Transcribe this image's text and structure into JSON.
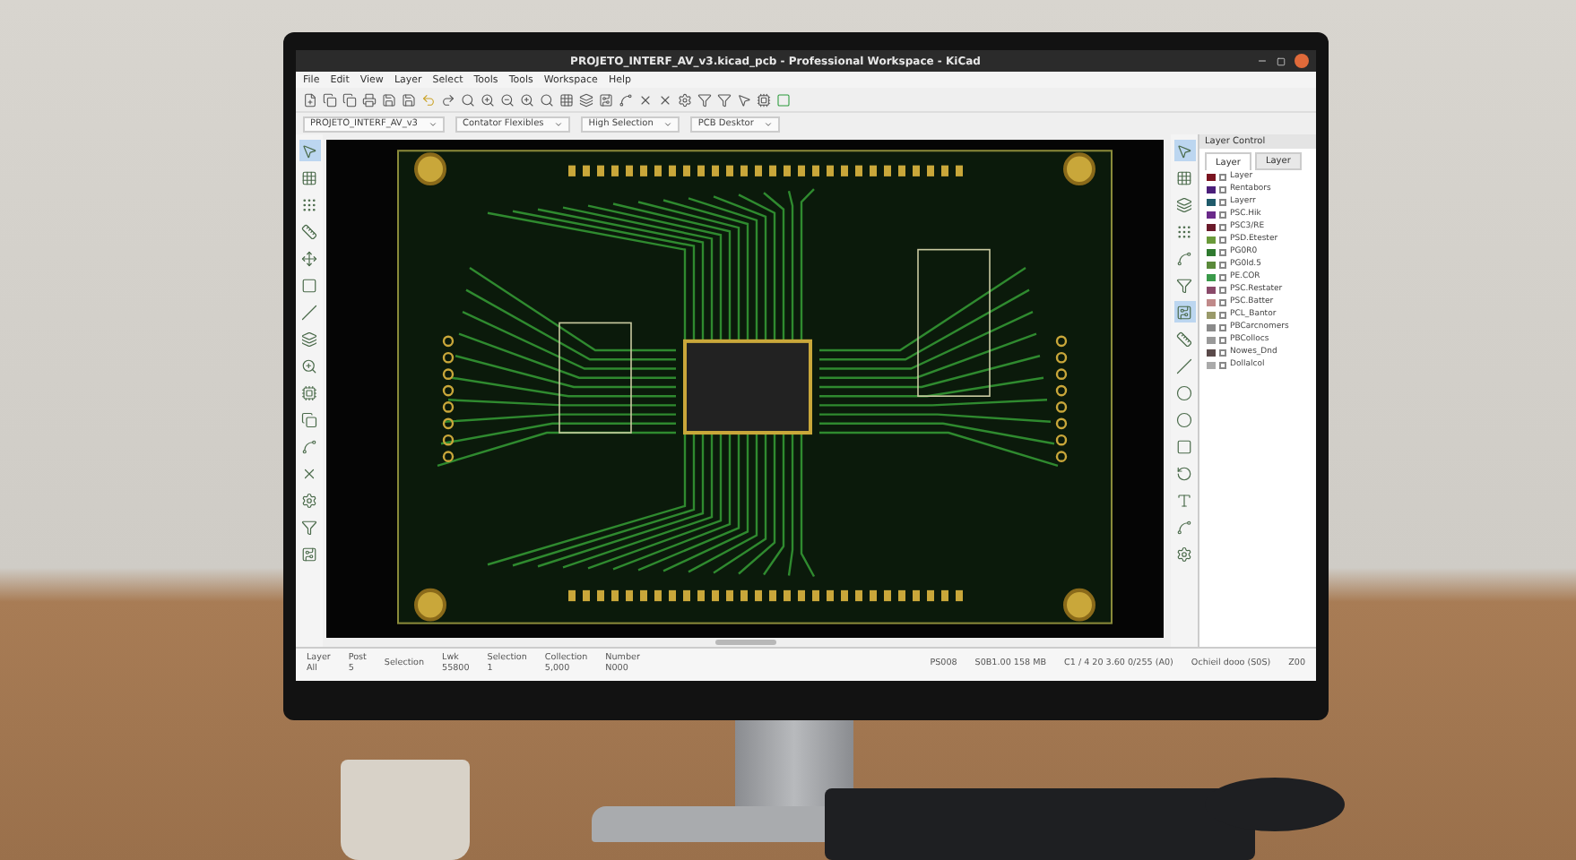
{
  "window": {
    "title": "PROJETO_INTERF_AV_v3.kicad_pcb - Professional Workspace - KiCad"
  },
  "menu": [
    "File",
    "Edit",
    "View",
    "Layer",
    "Select",
    "Tools",
    "Tools",
    "Workspace",
    "Help"
  ],
  "dropdowns": [
    "PROJETO_INTERF_AV_v3",
    "Contator Flexibles",
    "High Selection",
    "PCB Desktor"
  ],
  "left_toolbar": [
    {
      "kind": "pointer",
      "selected": true
    },
    {
      "kind": "grid",
      "selected": false
    },
    {
      "kind": "dots",
      "selected": false
    },
    {
      "kind": "ruler",
      "selected": false
    },
    {
      "kind": "move",
      "selected": false
    },
    {
      "kind": "rect",
      "selected": false
    },
    {
      "kind": "line",
      "selected": false
    },
    {
      "kind": "layers",
      "selected": false
    },
    {
      "kind": "zoom",
      "selected": false
    },
    {
      "kind": "component",
      "selected": false
    },
    {
      "kind": "copy",
      "selected": false
    },
    {
      "kind": "route",
      "selected": false
    },
    {
      "kind": "cross",
      "selected": false
    },
    {
      "kind": "gear",
      "selected": false
    },
    {
      "kind": "funnel",
      "selected": false
    },
    {
      "kind": "chip",
      "selected": false
    }
  ],
  "right_toolbar": [
    {
      "kind": "pointer",
      "selected": true
    },
    {
      "kind": "grid",
      "selected": false
    },
    {
      "kind": "layers",
      "selected": false
    },
    {
      "kind": "dots",
      "selected": false
    },
    {
      "kind": "route",
      "selected": false
    },
    {
      "kind": "funnel",
      "selected": false
    },
    {
      "kind": "chip",
      "selected": true
    },
    {
      "kind": "ruler",
      "selected": false
    },
    {
      "kind": "line",
      "selected": false
    },
    {
      "kind": "circle",
      "selected": false
    },
    {
      "kind": "circle",
      "selected": false
    },
    {
      "kind": "rect",
      "selected": false
    },
    {
      "kind": "arc",
      "selected": false
    },
    {
      "kind": "text",
      "selected": false
    },
    {
      "kind": "route",
      "selected": false
    },
    {
      "kind": "gear",
      "selected": false
    }
  ],
  "layer_panel": {
    "title": "Layer Control",
    "tabs": [
      {
        "label": "Layer",
        "selected": true
      },
      {
        "label": "Layer",
        "selected": false
      }
    ],
    "layers": [
      {
        "name": "Layer",
        "color": "#7a1420",
        "checked": false
      },
      {
        "name": "Rentabors",
        "color": "#4b1f7a",
        "checked": false
      },
      {
        "name": "Layerr",
        "color": "#1f5a6a",
        "checked": false
      },
      {
        "name": "PSC.Hik",
        "color": "#6a2a8a",
        "checked": false
      },
      {
        "name": "PSC3/RE",
        "color": "#6a1a2a",
        "checked": false
      },
      {
        "name": "PSD.Etester",
        "color": "#6a9a3a",
        "checked": false
      },
      {
        "name": "PG0R0",
        "color": "#2f7a2f",
        "checked": false
      },
      {
        "name": "PG0ld.5",
        "color": "#5a8a3a",
        "checked": false
      },
      {
        "name": "PE.COR",
        "color": "#3a9a4a",
        "checked": false
      },
      {
        "name": "PSC.Restater",
        "color": "#8a4a6a",
        "checked": false
      },
      {
        "name": "PSC.Batter",
        "color": "#c08a8a",
        "checked": false
      },
      {
        "name": "PCL_Bantor",
        "color": "#9a9a6a",
        "checked": false
      },
      {
        "name": "PBCarcnomers",
        "color": "#8a8a8a",
        "checked": false
      },
      {
        "name": "PBCollocs",
        "color": "#9a9a9a",
        "checked": false
      },
      {
        "name": "Nowes_Dnd",
        "color": "#5a4a4a",
        "checked": false
      },
      {
        "name": "Dollalcol",
        "color": "#aaaaaa",
        "checked": false
      }
    ]
  },
  "status_left": [
    {
      "label": "Layer",
      "value": "All"
    },
    {
      "label": "Post",
      "value": "5"
    },
    {
      "label": "Selection"
    },
    {
      "label": "Lwk",
      "value": "55800"
    },
    {
      "label": "Selection",
      "value": "1"
    },
    {
      "label": "Collection",
      "value": "5,000"
    },
    {
      "label": "Number",
      "value": "N000"
    }
  ],
  "status_right": [
    "PS008",
    "S0B1.00 158 MB",
    "C1 / 4 20 3.60 0/255 (A0)",
    "Ochieil dooo (S0S)",
    "Z00"
  ]
}
